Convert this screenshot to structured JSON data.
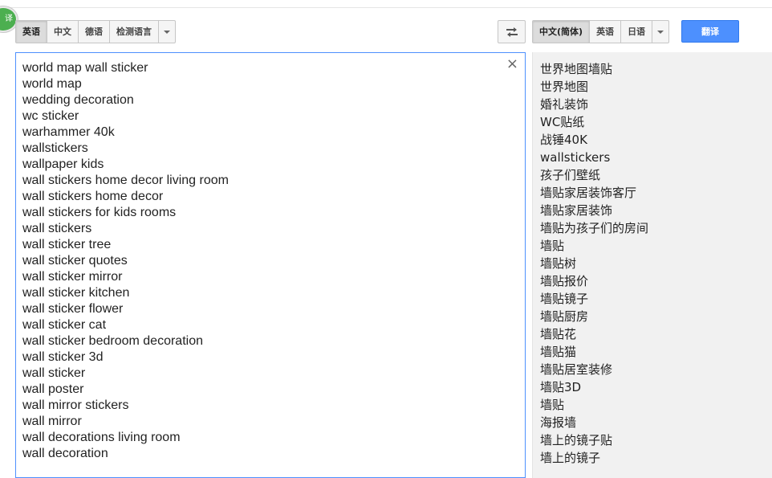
{
  "badge_text": "译",
  "source_languages": {
    "items": [
      "英语",
      "中文",
      "德语",
      "检测语言"
    ],
    "active_index": 0
  },
  "target_languages": {
    "items": [
      "中文(简体)",
      "英语",
      "日语"
    ],
    "active_index": 0
  },
  "translate_button": "翻译",
  "clear_symbol": "×",
  "source_lines": [
    "world map wall sticker",
    "world map",
    "wedding decoration",
    "wc sticker",
    "warhammer 40k",
    "wallstickers",
    "wallpaper kids",
    "wall stickers home decor living room",
    "wall stickers home decor",
    "wall stickers for kids rooms",
    "wall stickers",
    "wall sticker tree",
    "wall sticker quotes",
    "wall sticker mirror",
    "wall sticker kitchen",
    "wall sticker flower",
    "wall sticker cat",
    "wall sticker bedroom decoration",
    "wall sticker 3d",
    "wall sticker",
    "wall poster",
    "wall mirror stickers",
    "wall mirror",
    "wall decorations living room",
    "wall decoration"
  ],
  "result_lines": [
    "世界地图墙贴",
    "世界地图",
    "婚礼装饰",
    "WC贴纸",
    "战锤40K",
    "wallstickers",
    "孩子们壁纸",
    "墙贴家居装饰客厅",
    "墙贴家居装饰",
    "墙贴为孩子们的房间",
    "墙贴",
    "墙贴树",
    "墙贴报价",
    "墙贴镜子",
    "墙贴厨房",
    "墙贴花",
    "墙贴猫",
    "墙贴居室装修",
    "墙贴3D",
    "墙贴",
    "海报墙",
    "墙上的镜子贴",
    "墙上的镜子"
  ],
  "icons": {
    "swap": "swap-arrows-icon",
    "dropdown": "chevron-down-icon",
    "clear": "close-icon"
  },
  "colors": {
    "accent": "#4d90fe",
    "result_bg": "#f1f1f1",
    "badge": "#4caf50"
  }
}
